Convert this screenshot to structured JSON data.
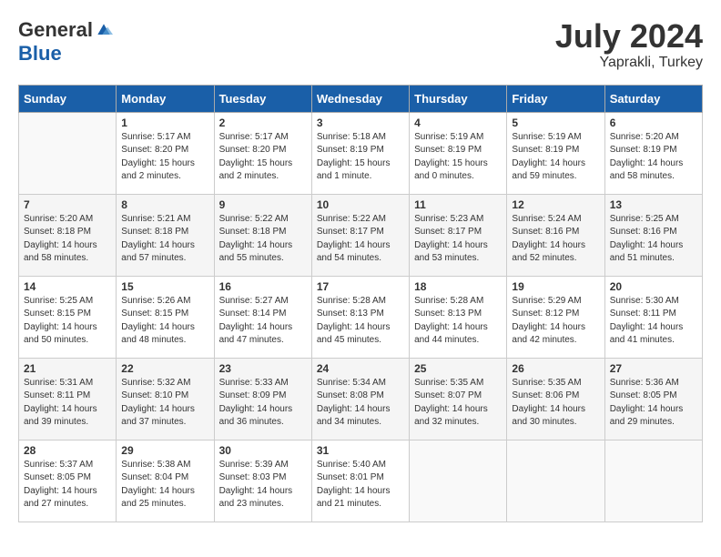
{
  "header": {
    "logo_general": "General",
    "logo_blue": "Blue",
    "month_year": "July 2024",
    "location": "Yaprakli, Turkey"
  },
  "weekdays": [
    "Sunday",
    "Monday",
    "Tuesday",
    "Wednesday",
    "Thursday",
    "Friday",
    "Saturday"
  ],
  "weeks": [
    [
      {
        "day": "",
        "info": ""
      },
      {
        "day": "1",
        "info": "Sunrise: 5:17 AM\nSunset: 8:20 PM\nDaylight: 15 hours\nand 2 minutes."
      },
      {
        "day": "2",
        "info": "Sunrise: 5:17 AM\nSunset: 8:20 PM\nDaylight: 15 hours\nand 2 minutes."
      },
      {
        "day": "3",
        "info": "Sunrise: 5:18 AM\nSunset: 8:19 PM\nDaylight: 15 hours\nand 1 minute."
      },
      {
        "day": "4",
        "info": "Sunrise: 5:19 AM\nSunset: 8:19 PM\nDaylight: 15 hours\nand 0 minutes."
      },
      {
        "day": "5",
        "info": "Sunrise: 5:19 AM\nSunset: 8:19 PM\nDaylight: 14 hours\nand 59 minutes."
      },
      {
        "day": "6",
        "info": "Sunrise: 5:20 AM\nSunset: 8:19 PM\nDaylight: 14 hours\nand 58 minutes."
      }
    ],
    [
      {
        "day": "7",
        "info": "Sunrise: 5:20 AM\nSunset: 8:18 PM\nDaylight: 14 hours\nand 58 minutes."
      },
      {
        "day": "8",
        "info": "Sunrise: 5:21 AM\nSunset: 8:18 PM\nDaylight: 14 hours\nand 57 minutes."
      },
      {
        "day": "9",
        "info": "Sunrise: 5:22 AM\nSunset: 8:18 PM\nDaylight: 14 hours\nand 55 minutes."
      },
      {
        "day": "10",
        "info": "Sunrise: 5:22 AM\nSunset: 8:17 PM\nDaylight: 14 hours\nand 54 minutes."
      },
      {
        "day": "11",
        "info": "Sunrise: 5:23 AM\nSunset: 8:17 PM\nDaylight: 14 hours\nand 53 minutes."
      },
      {
        "day": "12",
        "info": "Sunrise: 5:24 AM\nSunset: 8:16 PM\nDaylight: 14 hours\nand 52 minutes."
      },
      {
        "day": "13",
        "info": "Sunrise: 5:25 AM\nSunset: 8:16 PM\nDaylight: 14 hours\nand 51 minutes."
      }
    ],
    [
      {
        "day": "14",
        "info": "Sunrise: 5:25 AM\nSunset: 8:15 PM\nDaylight: 14 hours\nand 50 minutes."
      },
      {
        "day": "15",
        "info": "Sunrise: 5:26 AM\nSunset: 8:15 PM\nDaylight: 14 hours\nand 48 minutes."
      },
      {
        "day": "16",
        "info": "Sunrise: 5:27 AM\nSunset: 8:14 PM\nDaylight: 14 hours\nand 47 minutes."
      },
      {
        "day": "17",
        "info": "Sunrise: 5:28 AM\nSunset: 8:13 PM\nDaylight: 14 hours\nand 45 minutes."
      },
      {
        "day": "18",
        "info": "Sunrise: 5:28 AM\nSunset: 8:13 PM\nDaylight: 14 hours\nand 44 minutes."
      },
      {
        "day": "19",
        "info": "Sunrise: 5:29 AM\nSunset: 8:12 PM\nDaylight: 14 hours\nand 42 minutes."
      },
      {
        "day": "20",
        "info": "Sunrise: 5:30 AM\nSunset: 8:11 PM\nDaylight: 14 hours\nand 41 minutes."
      }
    ],
    [
      {
        "day": "21",
        "info": "Sunrise: 5:31 AM\nSunset: 8:11 PM\nDaylight: 14 hours\nand 39 minutes."
      },
      {
        "day": "22",
        "info": "Sunrise: 5:32 AM\nSunset: 8:10 PM\nDaylight: 14 hours\nand 37 minutes."
      },
      {
        "day": "23",
        "info": "Sunrise: 5:33 AM\nSunset: 8:09 PM\nDaylight: 14 hours\nand 36 minutes."
      },
      {
        "day": "24",
        "info": "Sunrise: 5:34 AM\nSunset: 8:08 PM\nDaylight: 14 hours\nand 34 minutes."
      },
      {
        "day": "25",
        "info": "Sunrise: 5:35 AM\nSunset: 8:07 PM\nDaylight: 14 hours\nand 32 minutes."
      },
      {
        "day": "26",
        "info": "Sunrise: 5:35 AM\nSunset: 8:06 PM\nDaylight: 14 hours\nand 30 minutes."
      },
      {
        "day": "27",
        "info": "Sunrise: 5:36 AM\nSunset: 8:05 PM\nDaylight: 14 hours\nand 29 minutes."
      }
    ],
    [
      {
        "day": "28",
        "info": "Sunrise: 5:37 AM\nSunset: 8:05 PM\nDaylight: 14 hours\nand 27 minutes."
      },
      {
        "day": "29",
        "info": "Sunrise: 5:38 AM\nSunset: 8:04 PM\nDaylight: 14 hours\nand 25 minutes."
      },
      {
        "day": "30",
        "info": "Sunrise: 5:39 AM\nSunset: 8:03 PM\nDaylight: 14 hours\nand 23 minutes."
      },
      {
        "day": "31",
        "info": "Sunrise: 5:40 AM\nSunset: 8:01 PM\nDaylight: 14 hours\nand 21 minutes."
      },
      {
        "day": "",
        "info": ""
      },
      {
        "day": "",
        "info": ""
      },
      {
        "day": "",
        "info": ""
      }
    ]
  ]
}
